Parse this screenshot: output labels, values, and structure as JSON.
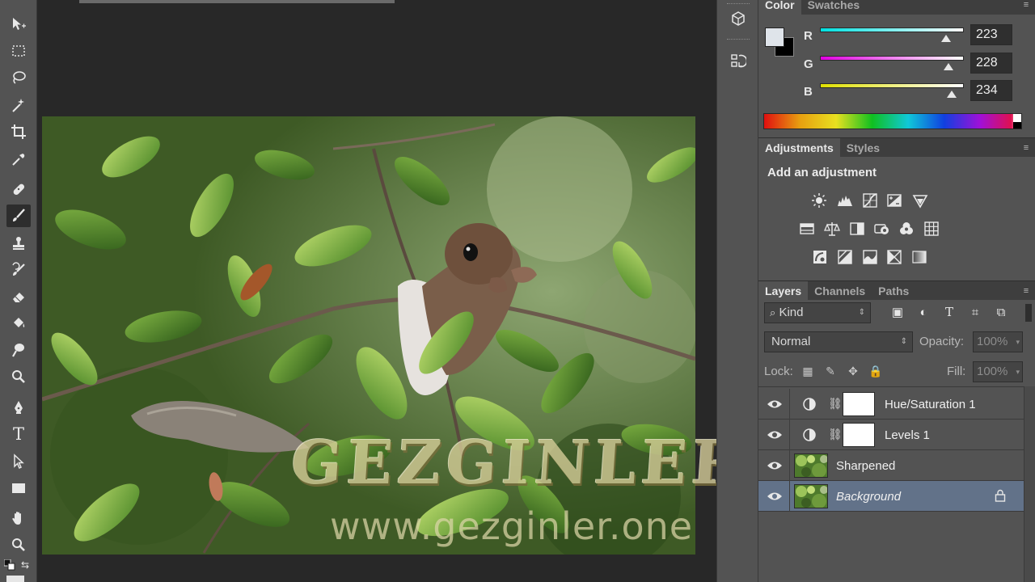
{
  "toolbar": {
    "tools": [
      "move-tool",
      "marquee-tool",
      "lasso-tool",
      "magic-wand-tool",
      "crop-tool",
      "eyedropper-tool",
      "healing-brush-tool",
      "brush-tool",
      "clone-stamp-tool",
      "history-brush-tool",
      "eraser-tool",
      "paint-bucket-tool",
      "dodge-tool",
      "zoom-tool",
      "pen-tool",
      "type-tool",
      "path-selection-tool",
      "rectangle-tool",
      "hand-tool",
      "zoom-tool-2"
    ],
    "active_tool": "brush-tool",
    "type_tool_label": "T"
  },
  "canvas": {
    "watermark_title": "GEZGINLER",
    "watermark_url": "www.gezginler.one"
  },
  "color_panel": {
    "tabs": [
      "Color",
      "Swatches"
    ],
    "active_tab": "Color",
    "foreground_color": "#dfe4ea",
    "background_color": "#000000",
    "channels": [
      {
        "label": "R",
        "value": "223",
        "fraction": 0.874,
        "gradient": [
          "#00e0e0",
          "#ffffff"
        ]
      },
      {
        "label": "G",
        "value": "228",
        "fraction": 0.894,
        "gradient": [
          "#e000e0",
          "#ffffff"
        ]
      },
      {
        "label": "B",
        "value": "234",
        "fraction": 0.918,
        "gradient": [
          "#e0e000",
          "#ffffff"
        ]
      }
    ]
  },
  "adjustments_panel": {
    "tabs": [
      "Adjustments",
      "Styles"
    ],
    "active_tab": "Adjustments",
    "title": "Add an adjustment",
    "icons": [
      "brightness-contrast-icon",
      "levels-icon",
      "curves-icon",
      "exposure-icon",
      "vibrance-icon",
      "hue-saturation-icon",
      "color-balance-icon",
      "black-white-icon",
      "photo-filter-icon",
      "channel-mixer-icon",
      "color-lookup-icon",
      "invert-icon",
      "posterize-icon",
      "threshold-icon",
      "selective-color-icon",
      "gradient-map-icon"
    ]
  },
  "layers_panel": {
    "tabs": [
      "Layers",
      "Channels",
      "Paths"
    ],
    "active_tab": "Layers",
    "filter_kind": "Kind",
    "blend_mode": "Normal",
    "opacity_label": "Opacity:",
    "opacity_value": "100%",
    "lock_label": "Lock:",
    "fill_label": "Fill:",
    "fill_value": "100%",
    "layers": [
      {
        "name": "Hue/Saturation 1",
        "kind": "adjustment",
        "visible": true,
        "selected": false
      },
      {
        "name": "Levels 1",
        "kind": "adjustment",
        "visible": true,
        "selected": false
      },
      {
        "name": "Sharpened",
        "kind": "image",
        "visible": true,
        "selected": false
      },
      {
        "name": "Background",
        "kind": "image",
        "visible": true,
        "selected": true,
        "locked": true
      }
    ]
  }
}
